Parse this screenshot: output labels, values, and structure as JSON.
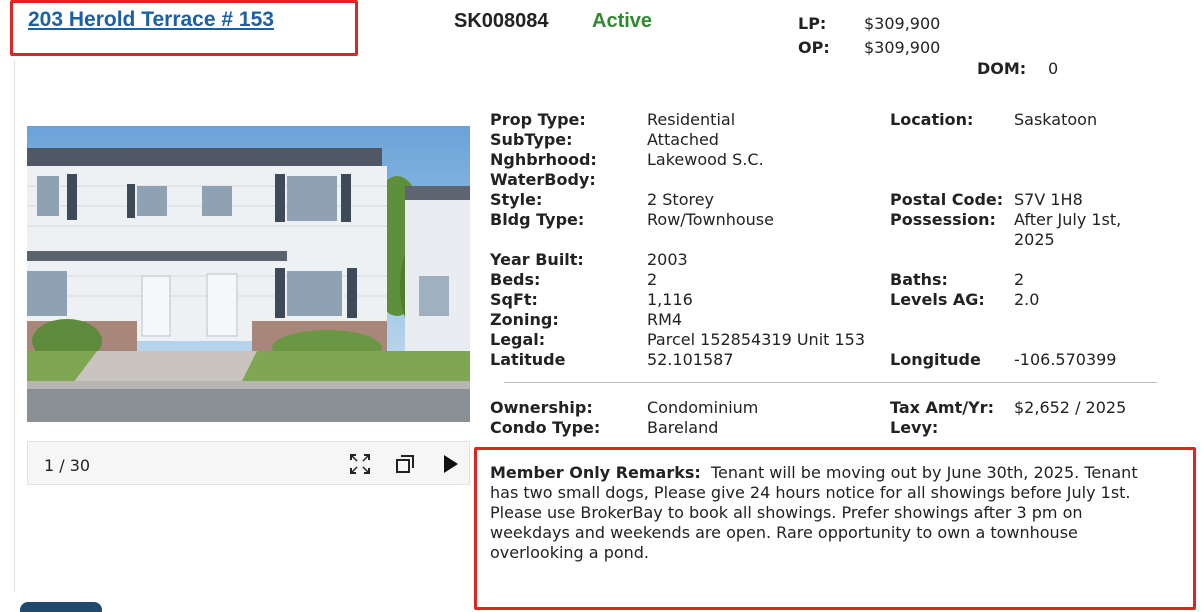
{
  "listing": {
    "address": "203 Herold Terrace # 153",
    "mls_number": "SK008084",
    "status": "Active",
    "status_color": "#2f8a2f"
  },
  "price": {
    "lp_label": "LP:",
    "lp_value": "$309,900",
    "op_label": "OP:",
    "op_value": "$309,900",
    "dom_label": "DOM:",
    "dom_value": "0"
  },
  "gallery": {
    "counter": "1 / 30",
    "fullscreen_icon": "fullscreen-icon",
    "popout_icon": "popout-icon",
    "play_icon": "play-icon"
  },
  "details": {
    "prop_type_label": "Prop Type:",
    "prop_type": "Residential",
    "subtype_label": "SubType:",
    "subtype": "Attached",
    "nghbrhood_label": "Nghbrhood:",
    "nghbrhood": "Lakewood S.C.",
    "waterbody_label": "WaterBody:",
    "style_label": "Style:",
    "style": "2 Storey",
    "bldg_type_label": "Bldg Type:",
    "bldg_type": "Row/Townhouse",
    "year_built_label": "Year Built:",
    "year_built": "2003",
    "beds_label": "Beds:",
    "beds": "2",
    "sqft_label": "SqFt:",
    "sqft": "1,116",
    "zoning_label": "Zoning:",
    "zoning": "RM4",
    "legal_label": "Legal:",
    "legal": "Parcel 152854319 Unit 153",
    "latitude_label": "Latitude",
    "latitude": "52.101587",
    "location_label": "Location:",
    "location": "Saskatoon",
    "postal_code_label": "Postal Code:",
    "postal_code": "S7V 1H8",
    "possession_label": "Possession:",
    "possession_line1": "After July 1st,",
    "possession_line2": "2025",
    "baths_label": "Baths:",
    "baths": "2",
    "levels_ag_label": "Levels AG:",
    "levels_ag": "2.0",
    "longitude_label": "Longitude",
    "longitude": "-106.570399",
    "ownership_label": "Ownership:",
    "ownership": "Condominium",
    "condo_type_label": "Condo Type:",
    "condo_type": "Bareland",
    "tax_label": "Tax Amt/Yr:",
    "tax": "$2,652 / 2025",
    "levy_label": "Levy:"
  },
  "remarks": {
    "label": "Member Only Remarks:",
    "line1": "Tenant will be moving out by June 30th, 2025. Tenant",
    "line2": "has two small dogs, Please give 24 hours notice for all showings before July 1st.",
    "line3": "Please use BrokerBay to book all showings. Prefer showings after 3 pm on",
    "line4": "weekdays and weekends are open. Rare opportunity to own a townhouse",
    "line5": "overlooking a pond."
  },
  "colors": {
    "link": "#1b5fa8",
    "highlight_box": "#e02424"
  }
}
